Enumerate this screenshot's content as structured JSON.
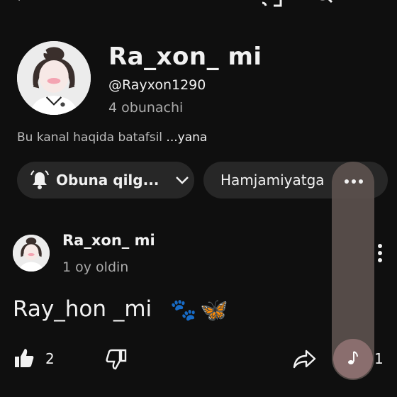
{
  "channel": {
    "name": "Ra_xon_ mi",
    "handle": "@Rayxon1290",
    "subscribers": "4 obunachi",
    "about": "Bu kanal haqida batafsil",
    "about_more": " ...yana"
  },
  "buttons": {
    "subscribe_label": "Obuna qilg...",
    "community_label": "Hamjamiyatga"
  },
  "post": {
    "author": "Ra_xon_ mi",
    "time": "1 oy oldin",
    "text": "Ray_hon _mi",
    "emoji_paws": "🐾",
    "emoji_butterfly": "🦋",
    "likes": "2",
    "comments": "1"
  },
  "icons": [
    "back-icon",
    "cast-icon",
    "search-icon",
    "more-vert-icon",
    "bell-icon",
    "chevron-down-icon",
    "more-horiz-icon",
    "like-icon",
    "dislike-icon",
    "share-icon",
    "music-note-icon"
  ]
}
